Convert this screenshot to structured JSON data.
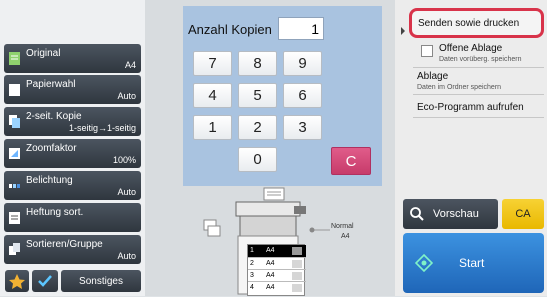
{
  "copies": {
    "label": "Anzahl Kopien",
    "value": "1"
  },
  "keypad": {
    "keys": [
      "7",
      "8",
      "9",
      "4",
      "5",
      "6",
      "1",
      "2",
      "3",
      "0"
    ],
    "clear": "C"
  },
  "left_menu": [
    {
      "label": "Original",
      "value": "A4"
    },
    {
      "label": "Papierwahl",
      "value": "Auto"
    },
    {
      "label": "2-seit. Kopie",
      "value": "1-seitig→1-seitig"
    },
    {
      "label": "Zoomfaktor",
      "value": "100%"
    },
    {
      "label": "Belichtung",
      "value": "Auto"
    },
    {
      "label": "Heftung sort.",
      "value": ""
    },
    {
      "label": "Sortieren/Gruppe",
      "value": "Auto"
    }
  ],
  "bottom_bar": {
    "sonstiges": "Sonstiges"
  },
  "right_menu": {
    "send_print": "Senden sowie drucken",
    "offene_ablage": "Offene Ablage",
    "offene_ablage_sub": "Daten vorüberg. speichern",
    "ablage": "Ablage",
    "ablage_sub": "Daten im Ordner speichern",
    "eco": "Eco-Programm aufrufen"
  },
  "actions": {
    "preview": "Vorschau",
    "ca": "CA",
    "start": "Start"
  },
  "output": {
    "mode": "Normal",
    "size": "A4"
  },
  "trays": [
    {
      "num": "1",
      "size": "A4",
      "selected": true
    },
    {
      "num": "2",
      "size": "A4",
      "selected": false
    },
    {
      "num": "3",
      "size": "A4",
      "selected": false
    },
    {
      "num": "4",
      "size": "A4",
      "selected": false
    }
  ],
  "colors": {
    "highlight": "#d8334a",
    "ca_button": "#f2c300",
    "start_button": "#2f7fd0",
    "clear_key": "#d94a7a"
  }
}
